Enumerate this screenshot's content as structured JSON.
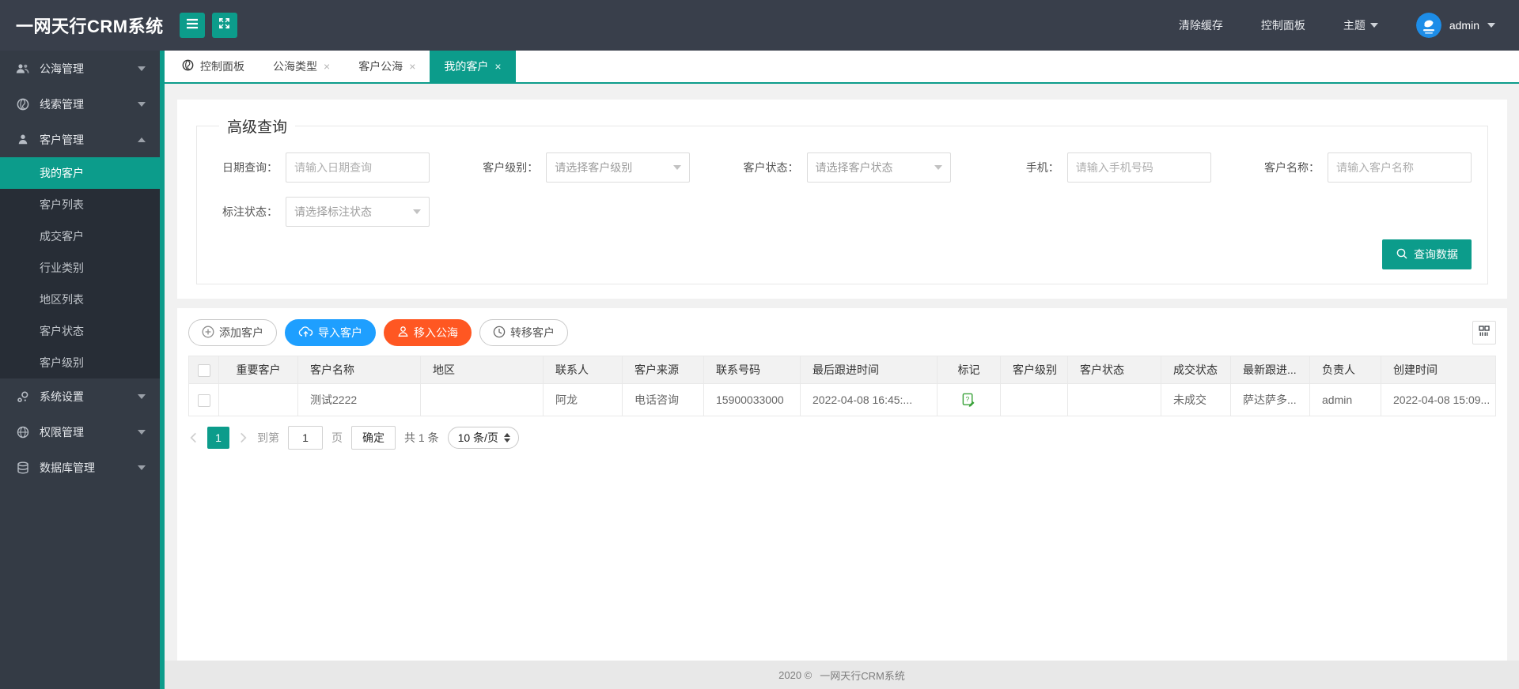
{
  "app": {
    "title": "一网天行CRM系统"
  },
  "header": {
    "logo": "一网天行CRM系统",
    "buttons": [
      {
        "icon": "menu-icon"
      },
      {
        "icon": "fullscreen-icon"
      }
    ],
    "nav": {
      "clear_cache": "清除缓存",
      "control_panel": "控制面板",
      "theme": "主题",
      "username": "admin"
    }
  },
  "sidebar": {
    "items": [
      {
        "label": "公海管理",
        "icon": "users-icon",
        "expanded": false
      },
      {
        "label": "线索管理",
        "icon": "globe-icon",
        "expanded": false
      },
      {
        "label": "客户管理",
        "icon": "user-icon",
        "expanded": true,
        "children": [
          "我的客户",
          "客户列表",
          "成交客户",
          "行业类别",
          "地区列表",
          "客户状态",
          "客户级别"
        ],
        "active_child": "我的客户"
      },
      {
        "label": "系统设置",
        "icon": "settings-icon",
        "expanded": false
      },
      {
        "label": "权限管理",
        "icon": "globe-grid-icon",
        "expanded": false
      },
      {
        "label": "数据库管理",
        "icon": "database-icon",
        "expanded": false
      }
    ]
  },
  "tabs": [
    {
      "label": "控制面板",
      "icon": "globe-icon",
      "closable": false,
      "active": false
    },
    {
      "label": "公海类型",
      "closable": true,
      "active": false
    },
    {
      "label": "客户公海",
      "closable": true,
      "active": false
    },
    {
      "label": "我的客户",
      "closable": true,
      "active": true
    }
  ],
  "query": {
    "legend": "高级查询",
    "fields": [
      {
        "label": "日期查询：",
        "type": "input",
        "placeholder": "请输入日期查询"
      },
      {
        "label": "客户级别：",
        "type": "select",
        "placeholder": "请选择客户级别"
      },
      {
        "label": "客户状态：",
        "type": "select",
        "placeholder": "请选择客户状态"
      },
      {
        "label": "手机：",
        "type": "input",
        "placeholder": "请输入手机号码"
      },
      {
        "label": "客户名称：",
        "type": "input",
        "placeholder": "请输入客户名称"
      },
      {
        "label": "标注状态：",
        "type": "select",
        "placeholder": "请选择标注状态"
      }
    ],
    "search_button": "查询数据"
  },
  "toolbar": {
    "add_customer": "添加客户",
    "import_customer": "导入客户",
    "move_to_sea": "移入公海",
    "transfer_customer": "转移客户",
    "grid_button_icon": "column-grid-icon"
  },
  "table": {
    "columns": [
      "重要客户",
      "客户名称",
      "地区",
      "联系人",
      "客户来源",
      "联系号码",
      "最后跟进时间",
      "标记",
      "客户级别",
      "客户状态",
      "成交状态",
      "最新跟进...",
      "负责人",
      "创建时间"
    ],
    "rows": [
      {
        "cells": [
          "",
          "测试2222",
          "",
          "阿龙",
          "电话咨询",
          "15900033000",
          "2022-04-08 16:45:...",
          "",
          "",
          "",
          "未成交",
          "萨达萨多...",
          "admin",
          "2022-04-08 15:09..."
        ],
        "mark_icon": "question-edit-icon"
      }
    ]
  },
  "pagination": {
    "current_page": "1",
    "goto_prefix": "到第",
    "goto_value": "1",
    "goto_suffix": "页",
    "confirm": "确定",
    "total": "共 1 条",
    "page_size": "10 条/页"
  },
  "footer": {
    "copyright": "2020 ©",
    "site": "一网天行CRM系统"
  },
  "colors": {
    "accent_teal": "#0c9c8b",
    "button_blue": "#1e9fff",
    "button_red": "#ff5722",
    "header_bg": "#393f4b",
    "sidebar_bg": "#343b45",
    "submenu_bg": "#272d36",
    "mark_green": "#3aa23a"
  }
}
